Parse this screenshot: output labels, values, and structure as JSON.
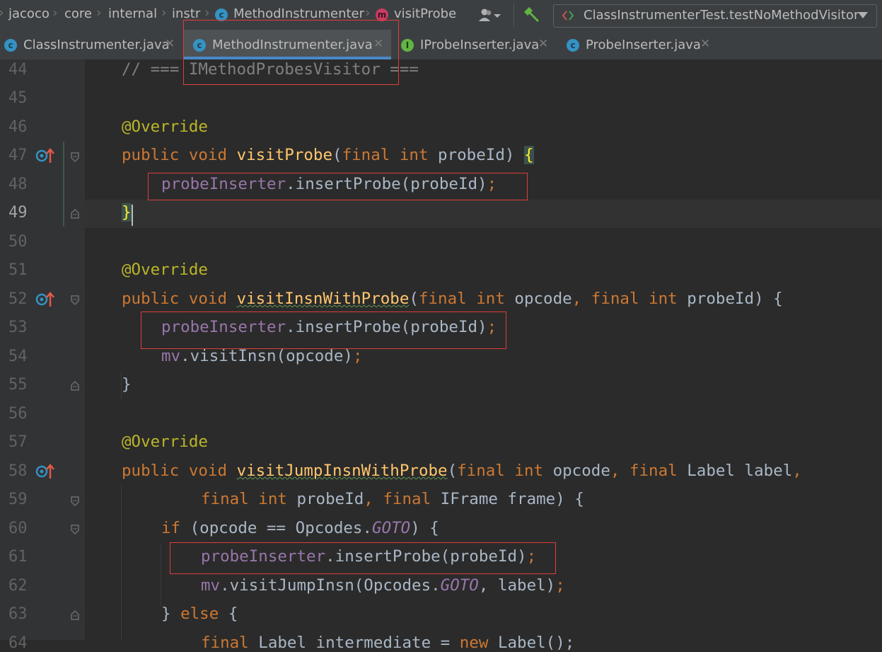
{
  "breadcrumb": {
    "items": [
      "jacoco",
      "core",
      "internal",
      "instr",
      "MethodInstrumenter",
      "visitProbe"
    ]
  },
  "run_config": {
    "label": "ClassInstrumenterTest.testNoMethodVisitor"
  },
  "tabs": [
    {
      "label": "ClassInstrumenter.java",
      "icon": "class-icon",
      "active": false
    },
    {
      "label": "MethodInstrumenter.java",
      "icon": "class-icon",
      "active": true
    },
    {
      "label": "IProbeInserter.java",
      "icon": "interface-icon",
      "active": false
    },
    {
      "label": "ProbeInserter.java",
      "icon": "class-icon",
      "active": false
    }
  ],
  "line_numbers": [
    "44",
    "45",
    "46",
    "47",
    "48",
    "49",
    "50",
    "51",
    "52",
    "53",
    "54",
    "55",
    "56",
    "57",
    "58",
    "59",
    "60",
    "61",
    "62",
    "63",
    "64"
  ],
  "current_line": "49",
  "code": {
    "l44_a": "// === ",
    "l44_b": "IMethodProbesVisitor",
    "l44_c": " ===",
    "ann": "@Override",
    "pub": "public",
    "void": "void",
    "final": "final",
    "int": "int",
    "if": "if",
    "else": "else",
    "new": "new",
    "visitProbe": "visitProbe",
    "visitInsnWithProbe": "visitInsnWithProbe",
    "visitJumpInsnWithProbe": "visitJumpInsnWithProbe",
    "probeInserter": "probeInserter",
    "mv": "mv",
    "insertProbe": ".insertProbe(probeId)",
    "semi": ";",
    "probeId": "probeId",
    "opcode": "opcode",
    "Label": "Label",
    "label": "label",
    "IFrame": "IFrame",
    "frame": "frame",
    "GOTO": "GOTO",
    "visitInsn": ".visitInsn(opcode)",
    "visitJumpInsn1": ".visitJumpInsn(Opcodes.",
    "visitJumpInsn2": ", label)",
    "if_open": " (opcode == Opcodes.",
    "if_close": ") {",
    "intermediate": "Label intermediate = ",
    "newLabel": "Label();"
  }
}
